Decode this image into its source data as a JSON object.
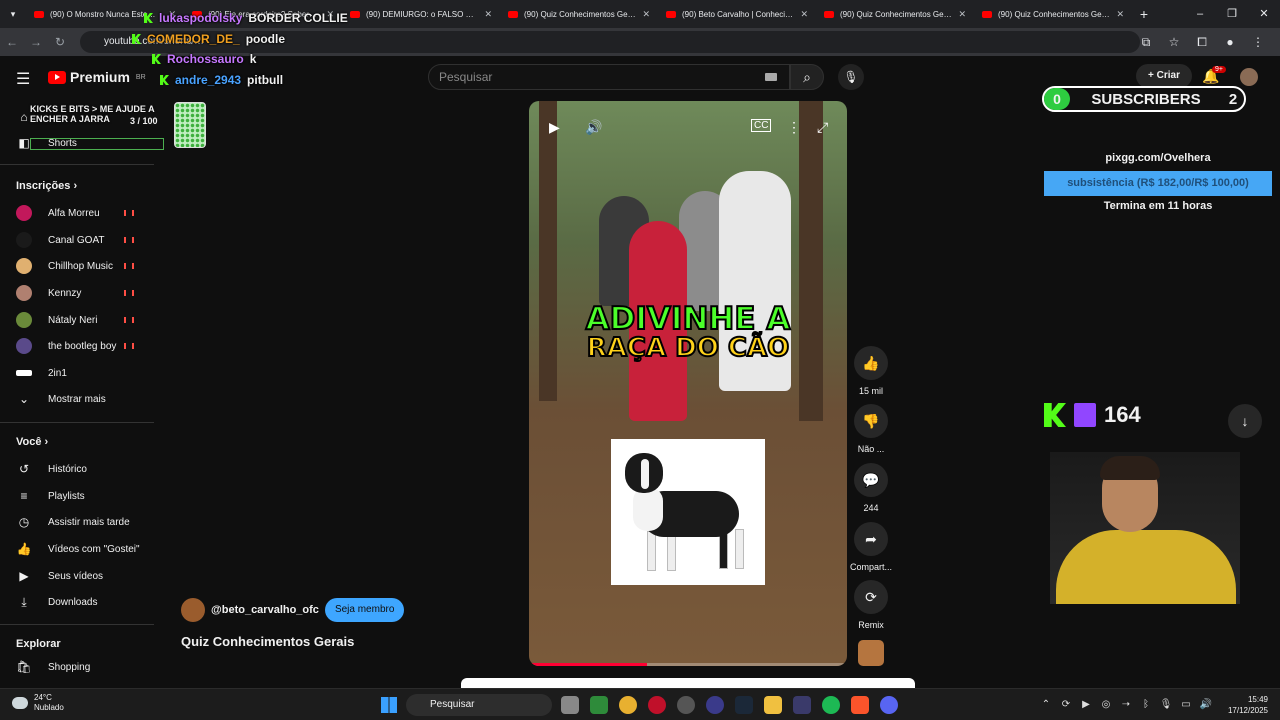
{
  "browser": {
    "tabs": [
      "(90) O Monstro Nunca Este…",
      "(90) Ele era cordeiro? Soberba…",
      "(90) DEMIURGO: o FALSO DEUS…",
      "(90) Quiz Conhecimentos Gerais",
      "(90) Beto Carvalho | Conhecim…",
      "(90) Quiz Conhecimentos Gerais",
      "(90) Quiz Conhecimentos Gerais"
    ],
    "url": "youtube.com/shorts/…"
  },
  "header": {
    "brand": "Premium",
    "region": "BR",
    "search_placeholder": "Pesquisar",
    "create_label": "Criar",
    "notif_count": "9+"
  },
  "sidebar": {
    "shorts_label": "Shorts",
    "subscriptions_heading": "Inscrições",
    "channels": [
      {
        "name": "Alfa Morreu",
        "color": "#c2185b"
      },
      {
        "name": "Canal GOAT",
        "color": "#1a1a1a"
      },
      {
        "name": "Chillhop Music",
        "color": "#e0b070"
      },
      {
        "name": "Kennzy",
        "color": "#b08070"
      },
      {
        "name": "Nátaly Neri",
        "color": "#6a8a3a"
      },
      {
        "name": "the bootleg boy",
        "color": "#5a4a8a"
      },
      {
        "name": "2in1",
        "color": "#ffffff"
      }
    ],
    "show_more": "Mostrar mais",
    "you_heading": "Você",
    "you_items": [
      "Histórico",
      "Playlists",
      "Assistir mais tarde",
      "Vídeos com \"Gostei\"",
      "Seus vídeos",
      "Downloads"
    ],
    "explore_heading": "Explorar",
    "explore_items": [
      "Shopping"
    ]
  },
  "chat": [
    {
      "user": "lukaspodolsky",
      "msg": "BORDER COLLIE",
      "color": "#c678ff"
    },
    {
      "user": "COMEDOR_DE_",
      "msg": "poodle",
      "color": "#f0a020"
    },
    {
      "user": "Rochossauro",
      "msg": "k",
      "color": "#c678ff"
    },
    {
      "user": "andre_2943",
      "msg": "pitbull",
      "color": "#4aa3ff"
    }
  ],
  "goal": {
    "title": "KICKS E BITS > ME AJUDE A ENCHER A JARRA",
    "current": "3",
    "target": "/ 100"
  },
  "subs_widget": {
    "left": "0",
    "label": "SUBSCRIBERS",
    "right": "2"
  },
  "pix": {
    "url": "pixgg.com/Ovelhera",
    "bar_label": "subsistência (R$ 182,00/R$ 100,00)",
    "ends": "Termina em 11 horas"
  },
  "viewer_count": "164",
  "short": {
    "caption_line1": "ADIVINHE A",
    "caption_line2": "RAÇA DO CÃO",
    "progress": 0.37,
    "channel": "@beto_carvalho_ofc",
    "member_btn": "Seja membro",
    "title": "Quiz Conhecimentos Gerais"
  },
  "actions": {
    "likes": "15 mil",
    "dislike": "Não ...",
    "comments": "244",
    "share": "Compart...",
    "remix": "Remix"
  },
  "taskbar": {
    "temp": "24°C",
    "weather": "Nublado",
    "search": "Pesquisar",
    "time": "15:49",
    "date": "17/12/2025"
  }
}
